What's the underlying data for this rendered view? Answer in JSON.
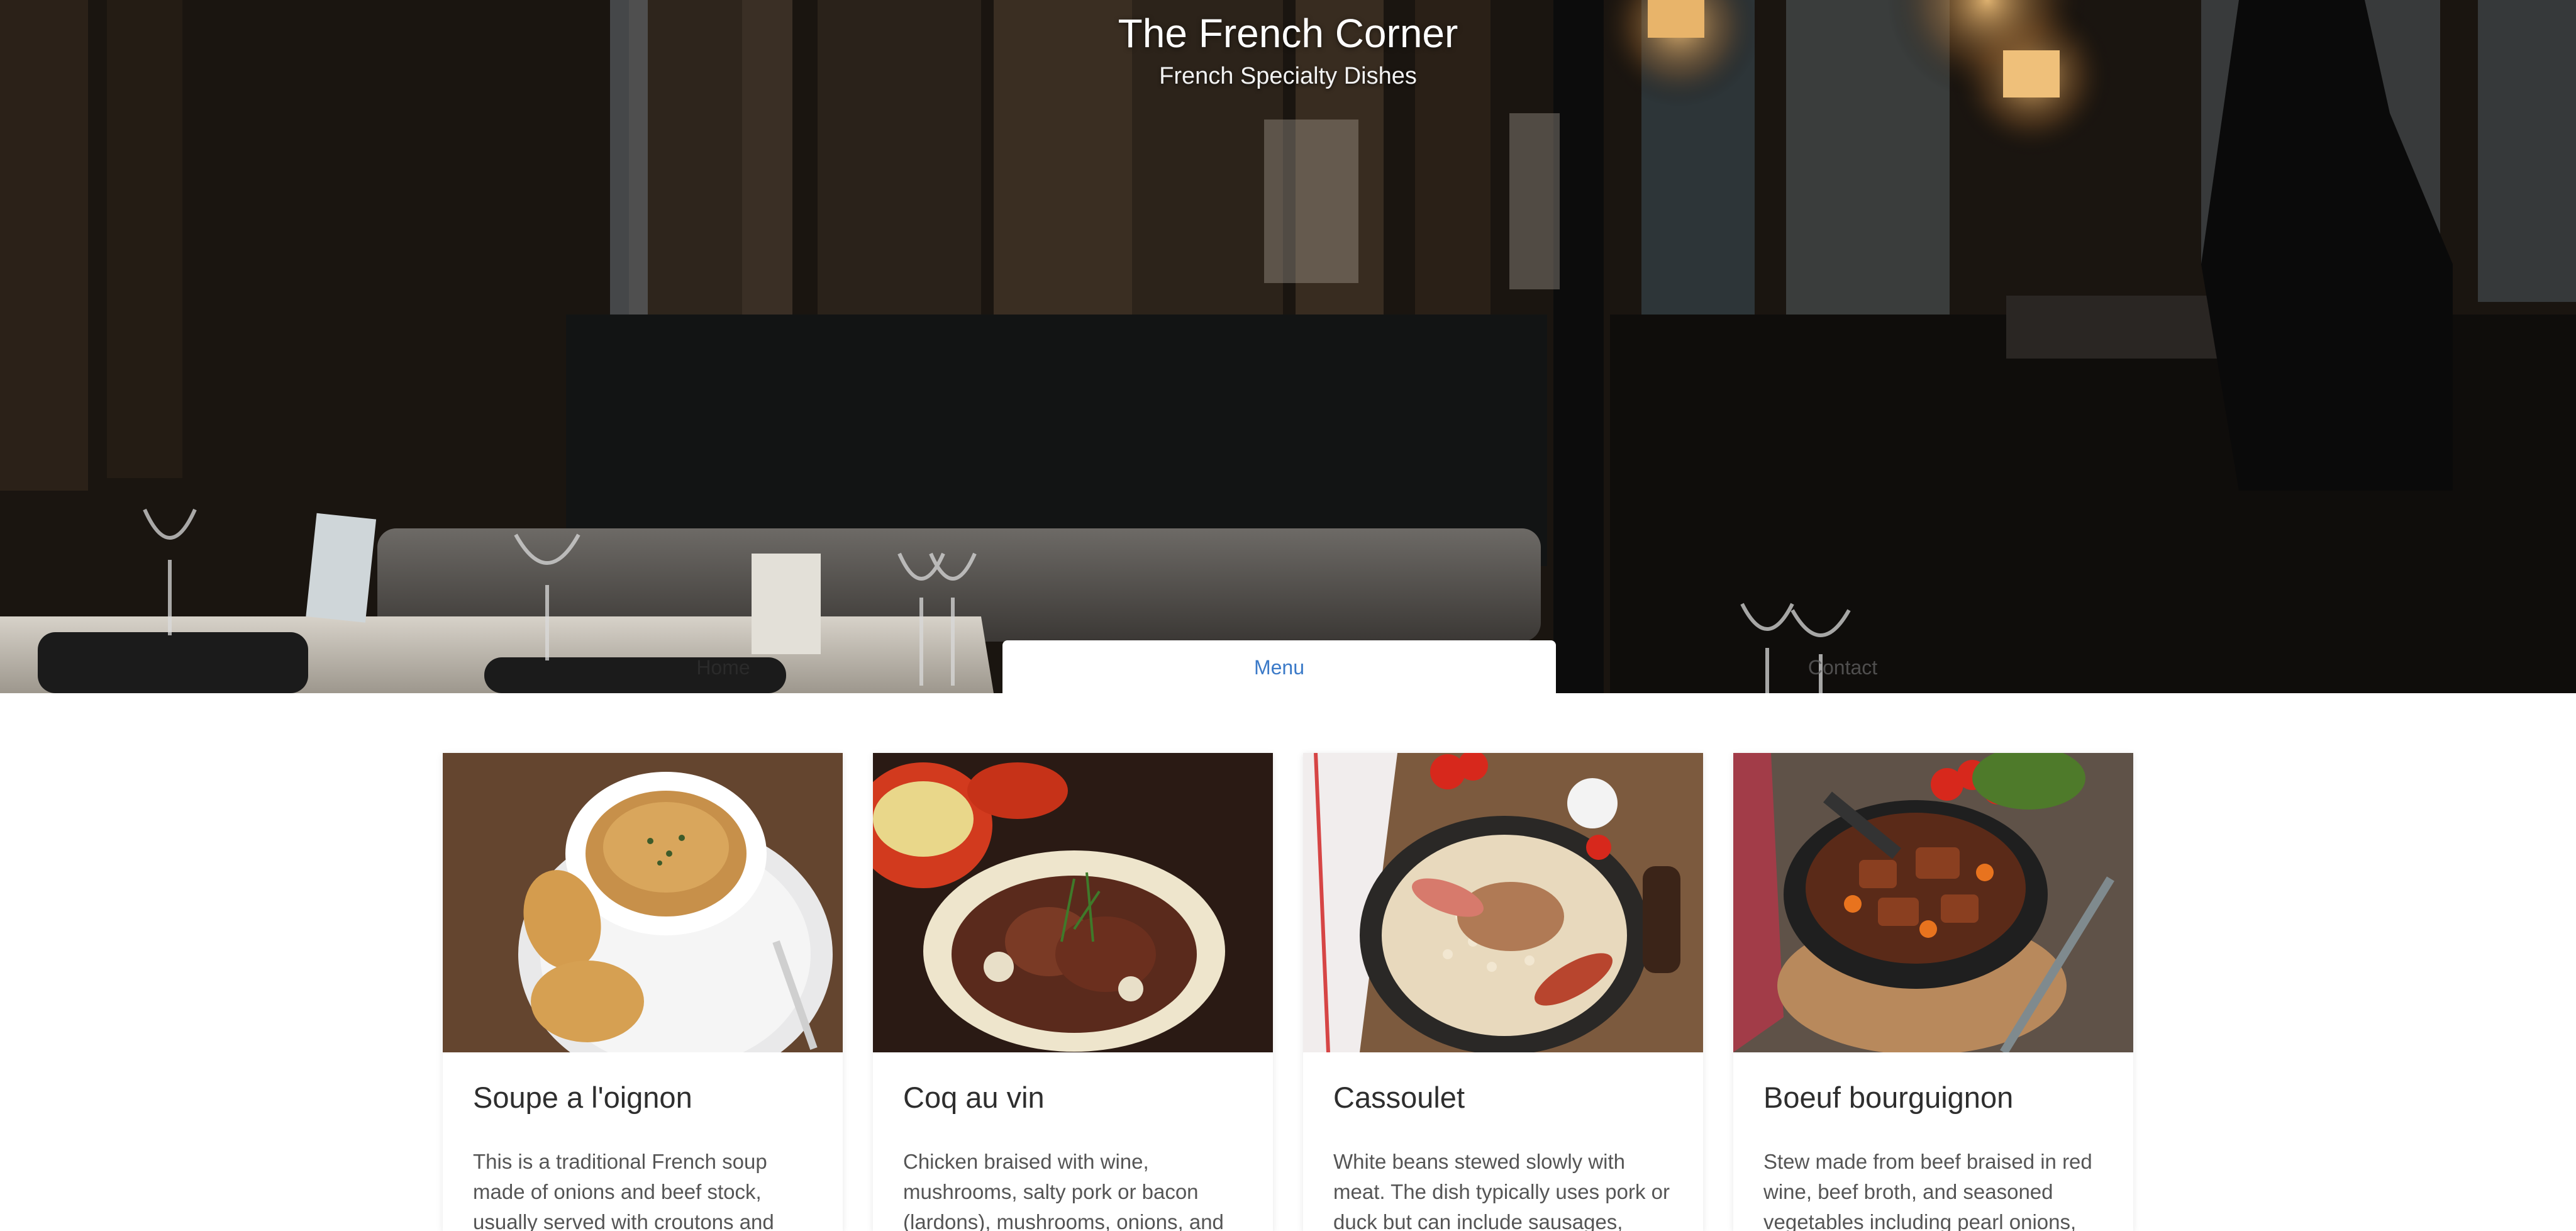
{
  "hero": {
    "title": "The French Corner",
    "subtitle": "French Specialty Dishes"
  },
  "nav": {
    "items": [
      {
        "label": "Home",
        "active": false
      },
      {
        "label": "Menu",
        "active": true
      },
      {
        "label": "Contact",
        "active": false
      }
    ]
  },
  "colors": {
    "accent": "#3b7ac8",
    "text_dark": "#2e2e2e",
    "text_body": "#555555"
  },
  "cards": [
    {
      "title": "Soupe a l'oignon",
      "description": "This is a traditional French soup made of onions and beef stock, usually served with croutons and",
      "image_icon": "onion-soup-image"
    },
    {
      "title": "Coq au vin",
      "description": "Chicken braised with wine, mushrooms, salty pork or bacon (lardons), mushrooms, onions, and",
      "image_icon": "coq-au-vin-image"
    },
    {
      "title": "Cassoulet",
      "description": "White beans stewed slowly with meat. The dish typically uses pork or duck but can include sausages,",
      "image_icon": "cassoulet-image"
    },
    {
      "title": "Boeuf bourguignon",
      "description": "Stew made from beef braised in red wine, beef broth, and seasoned vegetables including pearl onions,",
      "image_icon": "boeuf-bourguignon-image"
    }
  ]
}
